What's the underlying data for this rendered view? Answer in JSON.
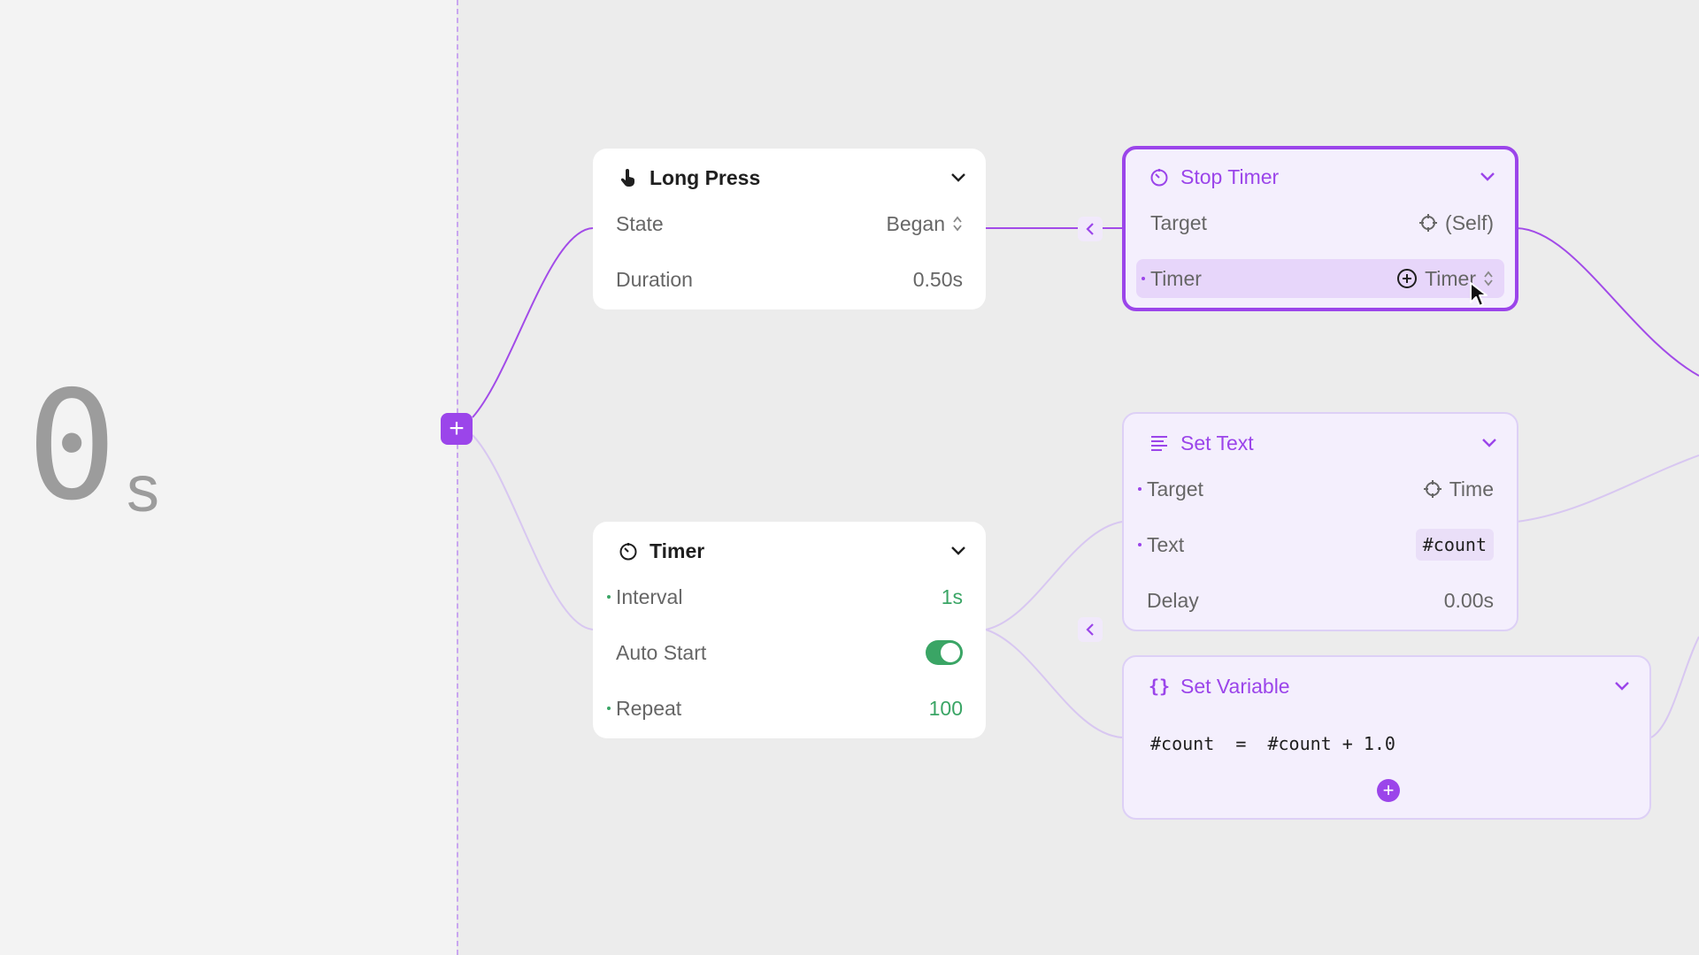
{
  "preview": {
    "value": "0",
    "unit": "s"
  },
  "nodes": {
    "long_press": {
      "title": "Long Press",
      "icon": "hand-tap-icon",
      "rows": [
        {
          "label": "State",
          "value": "Began"
        },
        {
          "label": "Duration",
          "value": "0.50s"
        }
      ]
    },
    "timer": {
      "title": "Timer",
      "icon": "timer-icon",
      "rows": [
        {
          "label": "Interval",
          "value": "1s"
        },
        {
          "label": "Auto Start",
          "value": "on"
        },
        {
          "label": "Repeat",
          "value": "100"
        }
      ]
    },
    "stop_timer": {
      "title": "Stop Timer",
      "icon": "timer-icon",
      "rows": [
        {
          "label": "Target",
          "value": "(Self)"
        },
        {
          "label": "Timer",
          "value": "Timer"
        }
      ]
    },
    "set_text": {
      "title": "Set Text",
      "icon": "text-lines-icon",
      "rows": [
        {
          "label": "Target",
          "value": "Time"
        },
        {
          "label": "Text",
          "value": "#count"
        },
        {
          "label": "Delay",
          "value": "0.00s"
        }
      ]
    },
    "set_variable": {
      "title": "Set Variable",
      "icon": "braces-icon",
      "expression": "#count  =  #count + 1.0"
    }
  },
  "colors": {
    "accent": "#9b45ea",
    "green": "#3aa565",
    "wire_active": "#a24be8",
    "wire_inactive": "#d8c7f1"
  }
}
